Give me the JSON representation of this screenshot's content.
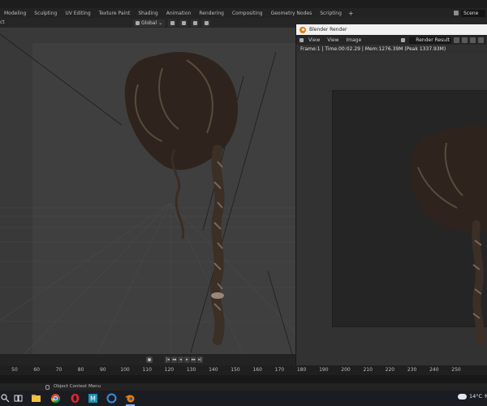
{
  "workspace_tabs": [
    "Modeling",
    "Sculpting",
    "UV Editing",
    "Texture Paint",
    "Shading",
    "Animation",
    "Rendering",
    "Compositing",
    "Geometry Nodes",
    "Scripting"
  ],
  "add_workspace": "+",
  "scene": {
    "label": "Scene"
  },
  "viewport_header": {
    "left_label": "ct",
    "orientation": "Global"
  },
  "render_window": {
    "title": "Blender Render",
    "menus": [
      "View",
      "View",
      "Image"
    ],
    "slot": "Render Result",
    "info": "Frame:1 | Time:00:02.29 | Mem:1276.39M (Peak 1337.93M)"
  },
  "timeline": {
    "ticks": [
      "50",
      "60",
      "70",
      "80",
      "90",
      "100",
      "110",
      "120",
      "130",
      "140",
      "150",
      "160",
      "170",
      "180",
      "190",
      "200",
      "210",
      "220",
      "230",
      "240",
      "250"
    ]
  },
  "status": {
    "text": "Object Context Menu"
  },
  "taskbar": {
    "apps": [
      "search-icon",
      "task-view-icon",
      "file-explorer-icon",
      "chrome-icon",
      "opera-icon",
      "app-icon",
      "edge-icon",
      "blender-icon"
    ],
    "temperature": "14°C",
    "extra": "N"
  },
  "colors": {
    "accent": "#e87d0d",
    "viewport": "#393939",
    "panel": "#232323"
  }
}
